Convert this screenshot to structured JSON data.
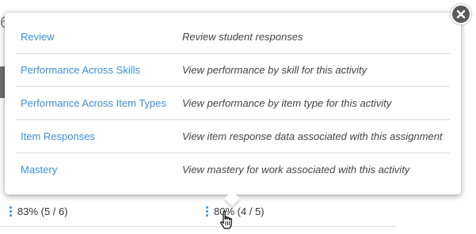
{
  "background": {
    "partial_digit": "6",
    "scores": [
      {
        "label": "83% (5 / 6)"
      },
      {
        "label": "80% (4 / 5)"
      }
    ]
  },
  "popover": {
    "items": [
      {
        "label": "Review",
        "description": "Review student responses"
      },
      {
        "label": "Performance Across Skills",
        "description": "View performance by skill for this activity"
      },
      {
        "label": "Performance Across Item Types",
        "description": "View performance by item type for this activity"
      },
      {
        "label": "Item Responses",
        "description": "View item response data associated with this assignment"
      },
      {
        "label": "Mastery",
        "description": "View mastery for work associated with this activity"
      }
    ],
    "close_icon": "close-icon"
  },
  "colors": {
    "link": "#3a8fd8",
    "close_button": "#5b5b5b",
    "description": "#444444"
  },
  "icons": {
    "kebab": "vertical-ellipsis-icon",
    "cursor": "hand-pointer-icon"
  }
}
